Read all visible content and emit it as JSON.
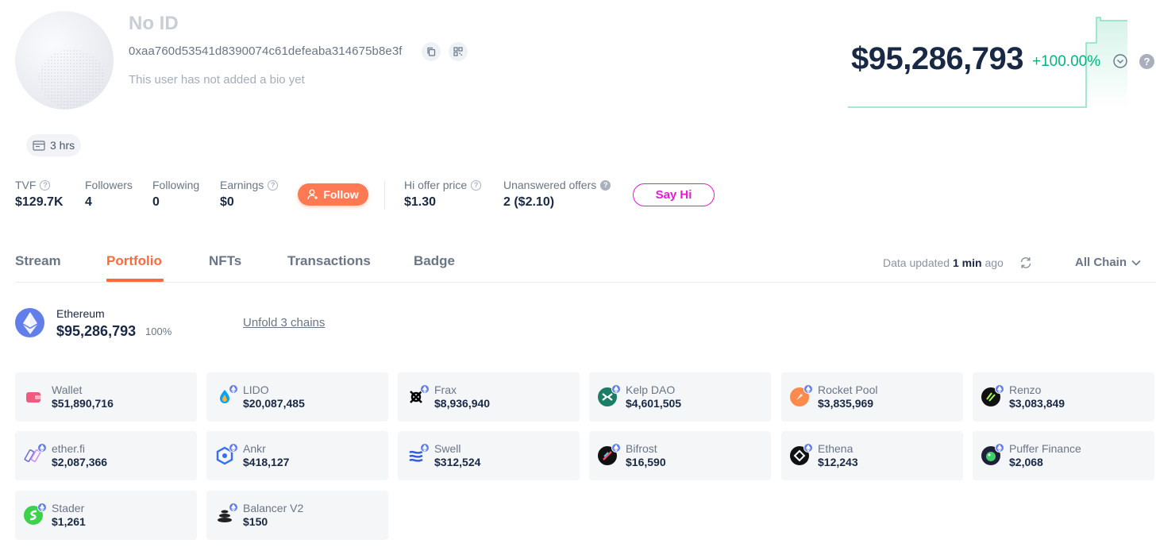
{
  "profile": {
    "name": "No ID",
    "address": "0xaa760d53541d8390074c61defeaba314675b8e3f",
    "bio": "This user has not added a bio yet",
    "age": "3 hrs"
  },
  "net_worth": {
    "value": "$95,286,793",
    "change": "+100.00%",
    "color_up": "#00b779"
  },
  "stats": {
    "tvf": {
      "label": "TVF",
      "value": "$129.7K"
    },
    "followers": {
      "label": "Followers",
      "value": "4"
    },
    "following": {
      "label": "Following",
      "value": "0"
    },
    "earnings": {
      "label": "Earnings",
      "value": "$0"
    },
    "follow_label": "Follow",
    "hi_offer": {
      "label": "Hi offer price",
      "value": "$1.30"
    },
    "unanswered": {
      "label": "Unanswered offers",
      "value": "2 ($2.10)"
    },
    "say_hi_label": "Say Hi"
  },
  "tabs": [
    "Stream",
    "Portfolio",
    "NFTs",
    "Transactions",
    "Badge"
  ],
  "active_tab": "Portfolio",
  "data_updated": {
    "prefix": "Data updated",
    "time": "1 min",
    "suffix": "ago"
  },
  "chain_filter": "All Chain",
  "chain_summary": {
    "name": "Ethereum",
    "value": "$95,286,793",
    "percent": "100%",
    "unfold_label": "Unfold 3 chains"
  },
  "protocols": [
    {
      "name": "Wallet",
      "value": "$51,890,716",
      "icon": "wallet-icon",
      "color": "#f05a7e"
    },
    {
      "name": "LIDO",
      "value": "$20,087,485",
      "icon": "lido-icon",
      "color": "#00a3ff"
    },
    {
      "name": "Frax",
      "value": "$8,936,940",
      "icon": "frax-icon",
      "color": "#000000"
    },
    {
      "name": "Kelp DAO",
      "value": "$4,601,505",
      "icon": "kelp-icon",
      "color": "#1b7d66"
    },
    {
      "name": "Rocket Pool",
      "value": "$3,835,969",
      "icon": "rocketpool-icon",
      "color": "#ff8a4c"
    },
    {
      "name": "Renzo",
      "value": "$3,083,849",
      "icon": "renzo-icon",
      "color": "#111111"
    },
    {
      "name": "ether.fi",
      "value": "$2,087,366",
      "icon": "etherfi-icon",
      "color": "#6a6ad8"
    },
    {
      "name": "Ankr",
      "value": "$418,127",
      "icon": "ankr-icon",
      "color": "#356df3"
    },
    {
      "name": "Swell",
      "value": "$312,524",
      "icon": "swell-icon",
      "color": "#2f5cdb"
    },
    {
      "name": "Bifrost",
      "value": "$16,590",
      "icon": "bifrost-icon",
      "color": "#111111"
    },
    {
      "name": "Ethena",
      "value": "$12,243",
      "icon": "ethena-icon",
      "color": "#111111"
    },
    {
      "name": "Puffer Finance",
      "value": "$2,068",
      "icon": "puffer-icon",
      "color": "#1f1f3a"
    },
    {
      "name": "Stader",
      "value": "$1,261",
      "icon": "stader-icon",
      "color": "#3bd34b"
    },
    {
      "name": "Balancer V2",
      "value": "$150",
      "icon": "balancer-icon",
      "color": "#222222"
    }
  ]
}
